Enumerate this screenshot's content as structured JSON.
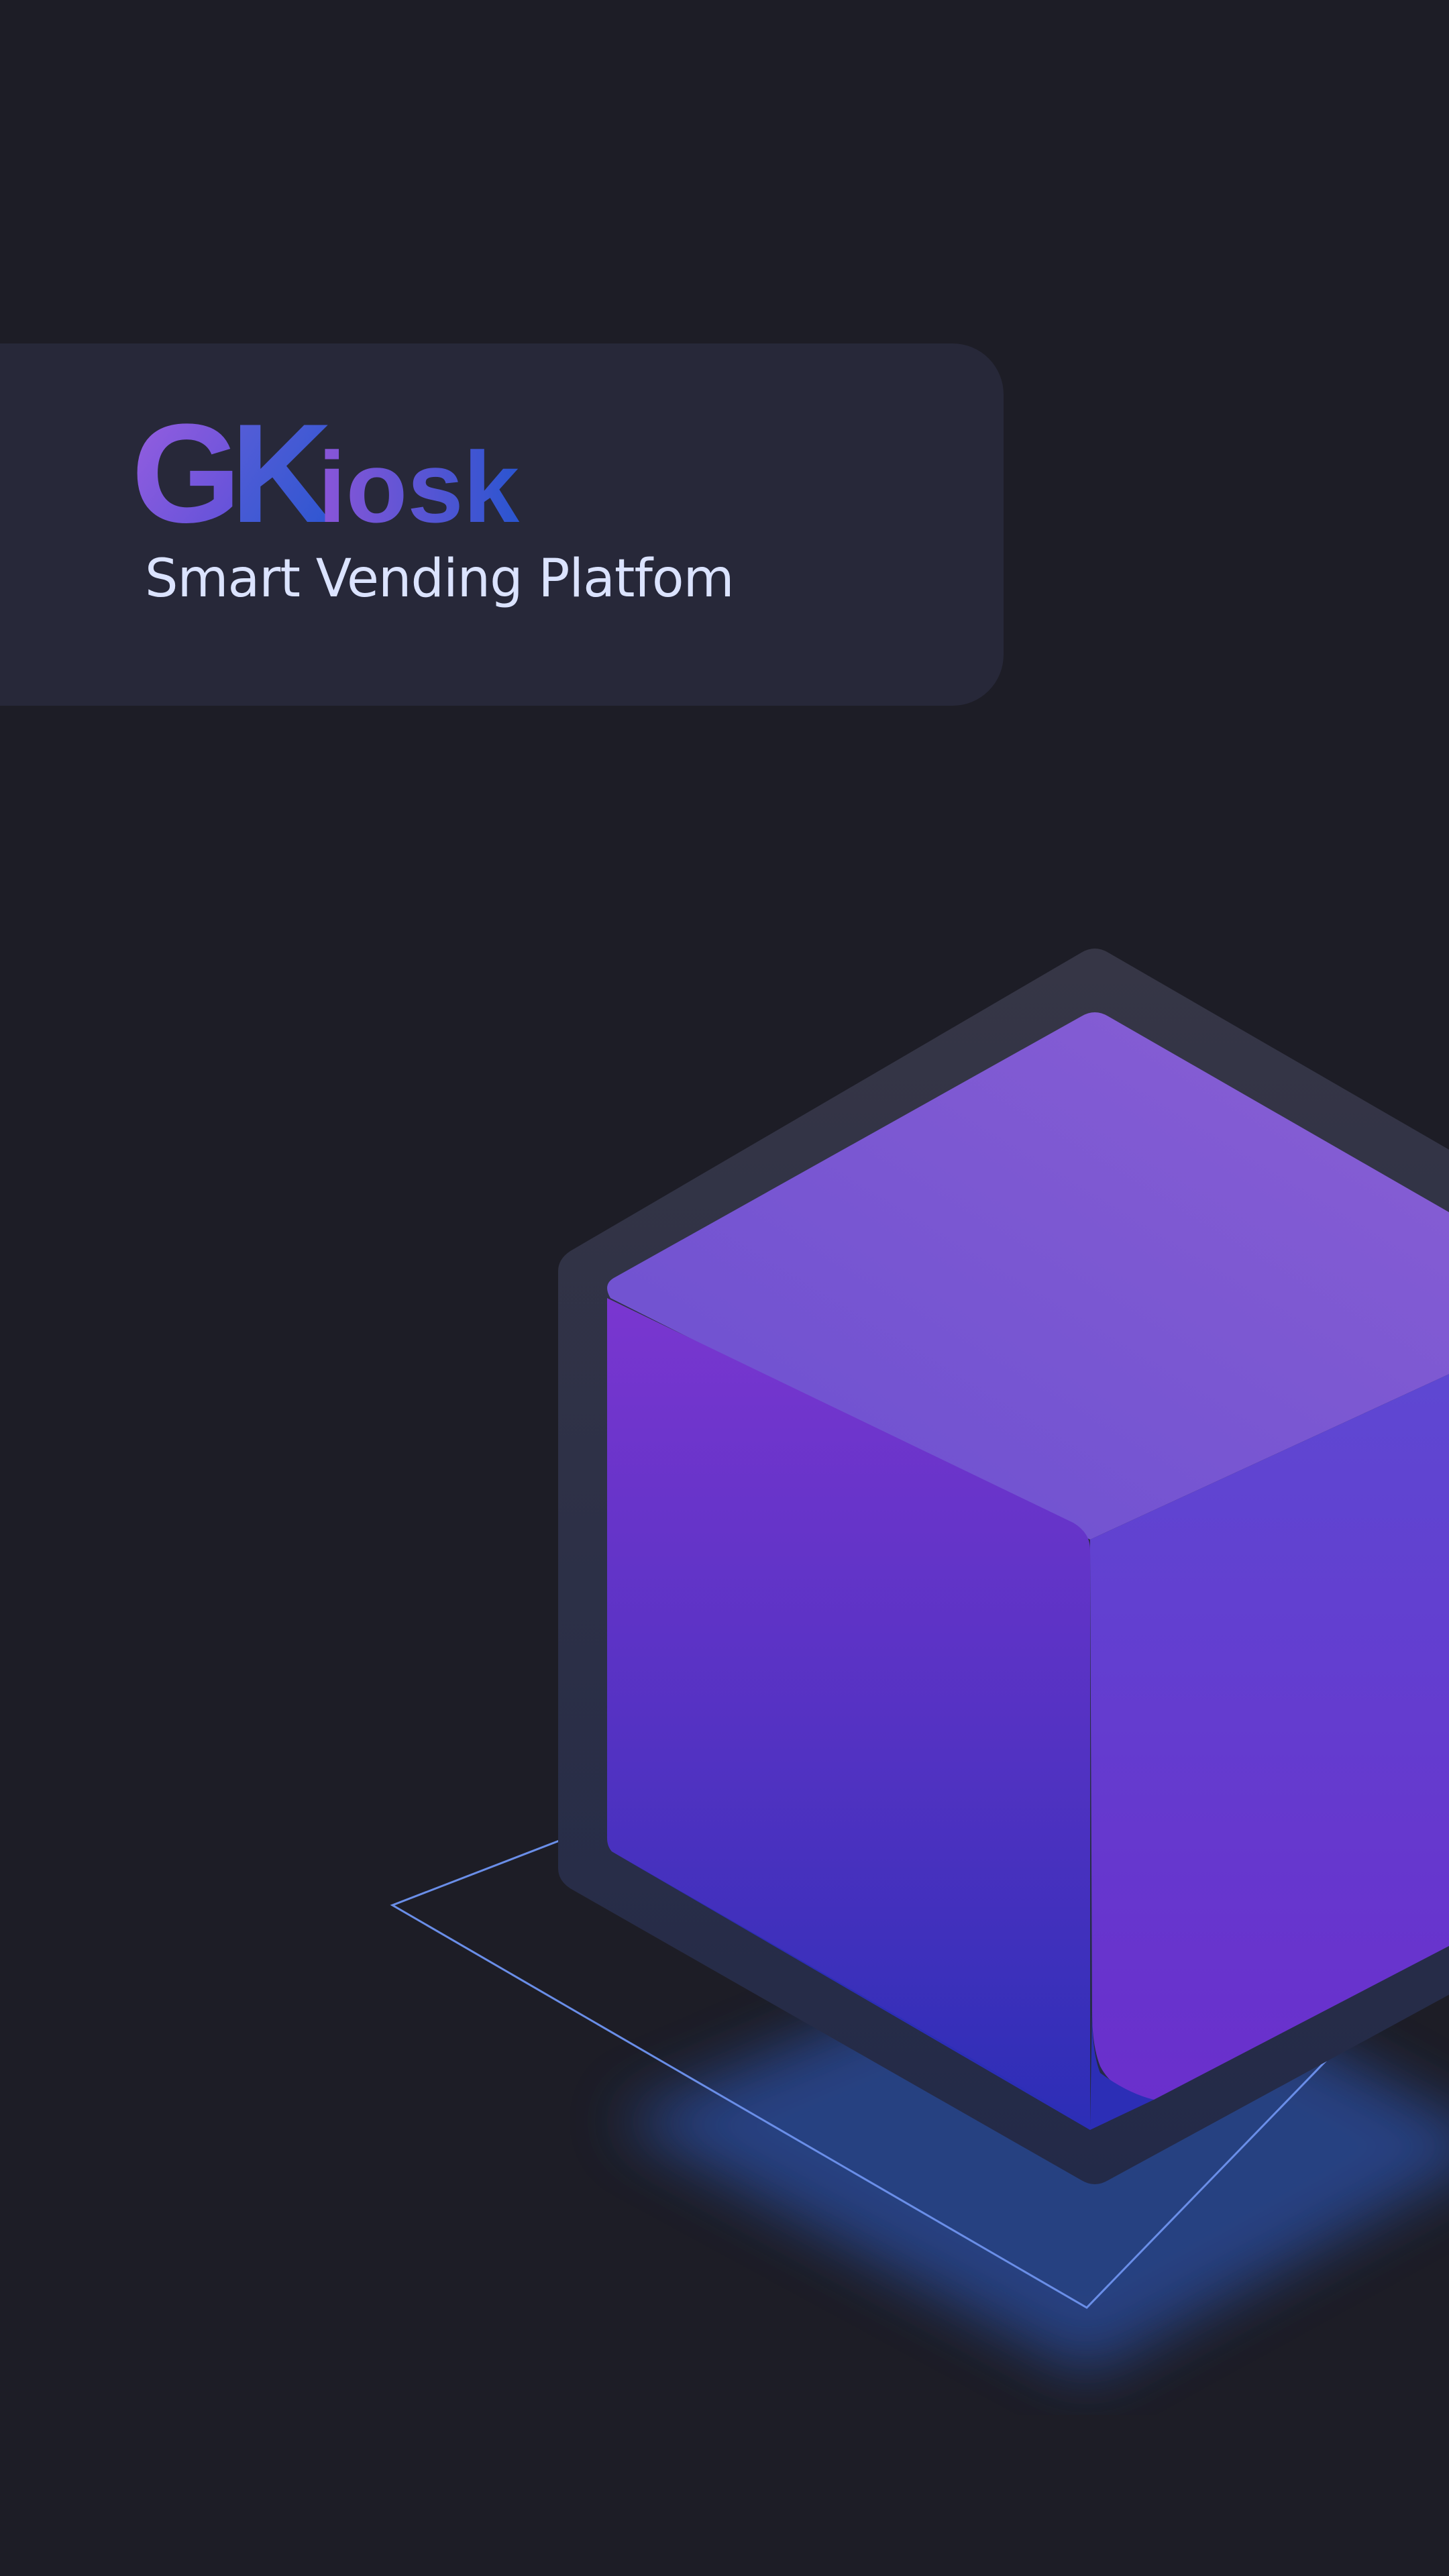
{
  "app": {
    "logo_text": "GKiosk",
    "logo_parts": [
      "G",
      "K",
      "iosk"
    ],
    "tagline": "Smart Vending Platfom"
  },
  "illustration": {
    "name": "isometric-cube",
    "colors": {
      "background": "#1d1d26",
      "card": "#272839",
      "cube_top": "#7a5ad2",
      "cube_left_top": "#7a36d0",
      "cube_left_bottom": "#3430b8",
      "cube_right": "#6a3ad0",
      "outline": "#6a8ee8",
      "glow": "#2a4a9a"
    }
  }
}
